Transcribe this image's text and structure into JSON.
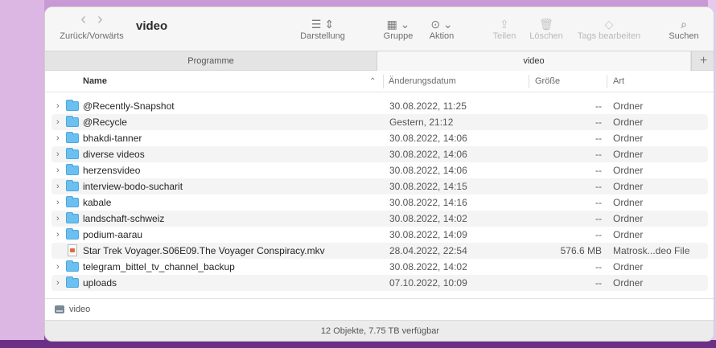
{
  "window": {
    "title": "video"
  },
  "toolbar": {
    "nav_label": "Zurück/Vorwärts",
    "back_glyph": "‹",
    "forward_glyph": "›",
    "items": [
      {
        "id": "darstellung",
        "label": "Darstellung",
        "glyph": "☰ ⇕",
        "icon": "list-view-icon",
        "enabled": true
      },
      {
        "id": "gruppe",
        "label": "Gruppe",
        "glyph": "▦ ⌄",
        "icon": "group-icon",
        "enabled": true
      },
      {
        "id": "aktion",
        "label": "Aktion",
        "glyph": "⊙ ⌄",
        "icon": "action-icon",
        "enabled": true
      },
      {
        "id": "teilen",
        "label": "Teilen",
        "glyph": "⇪",
        "icon": "share-icon",
        "enabled": false
      },
      {
        "id": "loeschen",
        "label": "Löschen",
        "glyph": "🗑",
        "icon": "trash-icon",
        "enabled": false
      },
      {
        "id": "tags",
        "label": "Tags bearbeiten",
        "glyph": "◇",
        "icon": "tag-icon",
        "enabled": false
      },
      {
        "id": "suchen",
        "label": "Suchen",
        "glyph": "⌕",
        "icon": "search-icon",
        "enabled": true
      }
    ]
  },
  "tabs": [
    {
      "label": "Programme",
      "active": false
    },
    {
      "label": "video",
      "active": true
    }
  ],
  "tab_add_glyph": "+",
  "columns": {
    "name": "Name",
    "date": "Änderungsdatum",
    "size": "Größe",
    "kind": "Art"
  },
  "sort_glyph": "⌃",
  "rows": [
    {
      "name": "@Recently-Snapshot",
      "date": "30.08.2022, 11:25",
      "size": "--",
      "kind": "Ordner",
      "type": "folder",
      "expandable": true
    },
    {
      "name": "@Recycle",
      "date": "Gestern, 21:12",
      "size": "--",
      "kind": "Ordner",
      "type": "folder",
      "expandable": true
    },
    {
      "name": "bhakdi-tanner",
      "date": "30.08.2022, 14:06",
      "size": "--",
      "kind": "Ordner",
      "type": "folder",
      "expandable": true
    },
    {
      "name": "diverse videos",
      "date": "30.08.2022, 14:06",
      "size": "--",
      "kind": "Ordner",
      "type": "folder",
      "expandable": true
    },
    {
      "name": "herzensvideo",
      "date": "30.08.2022, 14:06",
      "size": "--",
      "kind": "Ordner",
      "type": "folder",
      "expandable": true
    },
    {
      "name": "interview-bodo-sucharit",
      "date": "30.08.2022, 14:15",
      "size": "--",
      "kind": "Ordner",
      "type": "folder",
      "expandable": true
    },
    {
      "name": "kabale",
      "date": "30.08.2022, 14:16",
      "size": "--",
      "kind": "Ordner",
      "type": "folder",
      "expandable": true
    },
    {
      "name": "landschaft-schweiz",
      "date": "30.08.2022, 14:02",
      "size": "--",
      "kind": "Ordner",
      "type": "folder",
      "expandable": true
    },
    {
      "name": "podium-aarau",
      "date": "30.08.2022, 14:09",
      "size": "--",
      "kind": "Ordner",
      "type": "folder",
      "expandable": true
    },
    {
      "name": "Star Trek Voyager.S06E09.The Voyager Conspiracy.mkv",
      "date": "28.04.2022, 22:54",
      "size": "576.6 MB",
      "kind": "Matrosk...deo File",
      "type": "file",
      "expandable": false
    },
    {
      "name": "telegram_bittel_tv_channel_backup",
      "date": "30.08.2022, 14:02",
      "size": "--",
      "kind": "Ordner",
      "type": "folder",
      "expandable": true
    },
    {
      "name": "uploads",
      "date": "07.10.2022, 10:09",
      "size": "--",
      "kind": "Ordner",
      "type": "folder",
      "expandable": true
    }
  ],
  "pathbar": {
    "item": "video"
  },
  "status": {
    "text": "12 Objekte, 7.75 TB verfügbar"
  }
}
